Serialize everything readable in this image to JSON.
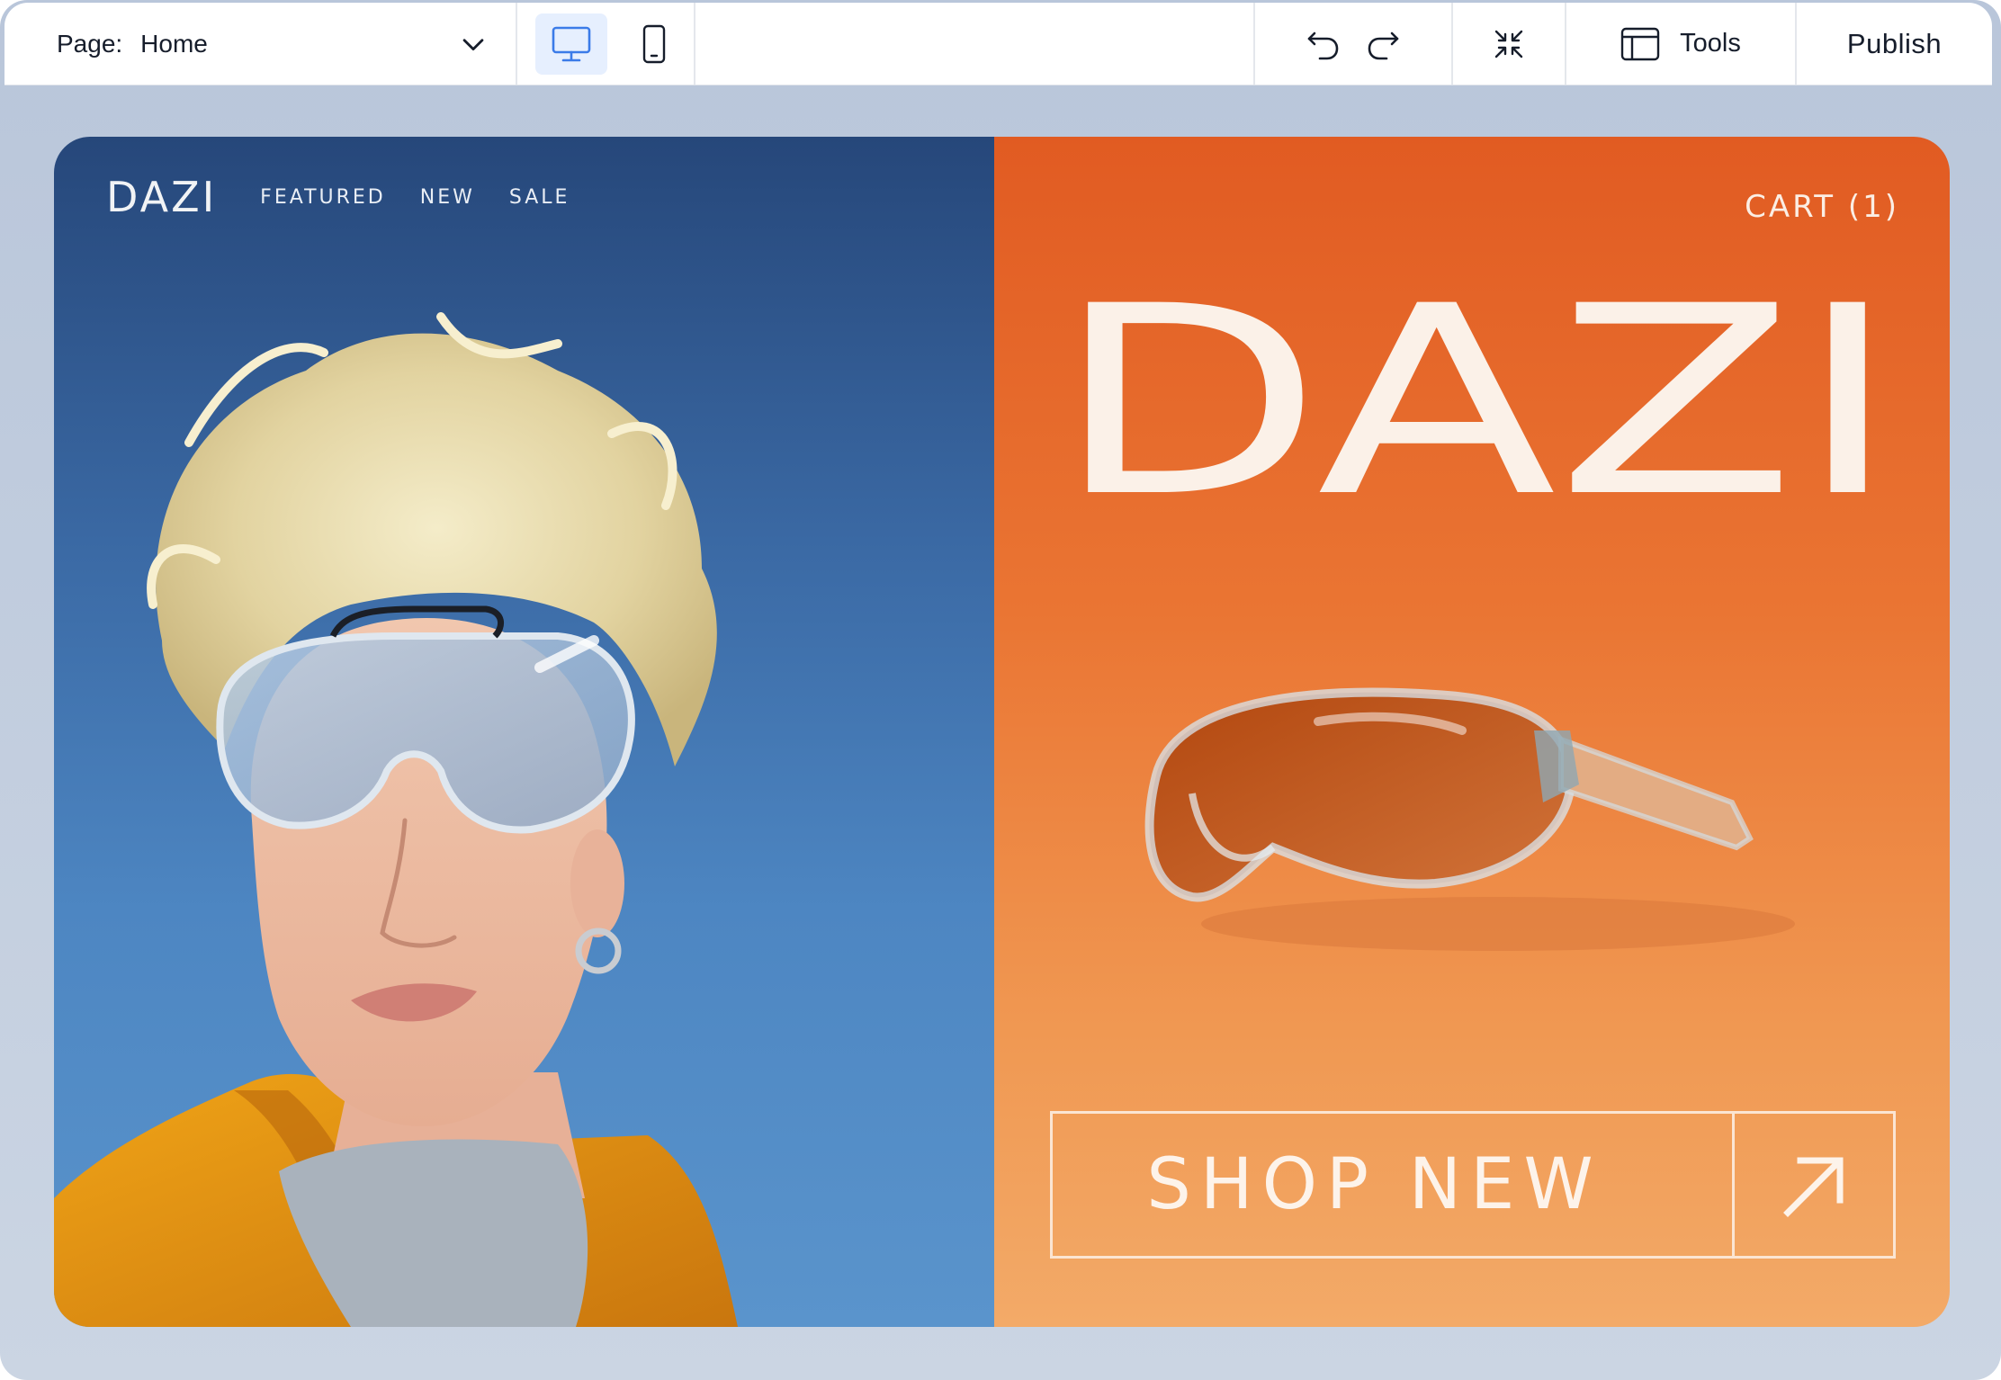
{
  "toolbar": {
    "page_key": "Page:",
    "page_value": "Home",
    "tools_label": "Tools",
    "publish_label": "Publish",
    "active_device": "desktop"
  },
  "site": {
    "logo_small": "DAZI",
    "nav": [
      "FEATURED",
      "NEW",
      "SALE"
    ],
    "cart": "CART (1)",
    "hero_title": "DAZI",
    "cta_label": "SHOP NEW"
  },
  "colors": {
    "accent_blue": "#3b7be8",
    "left_panel": "#3b6aa5",
    "right_panel": "#e8692b",
    "cream": "#fbf1e8"
  },
  "icons": {
    "page_dropdown": "chevron-down-icon",
    "desktop": "desktop-icon",
    "mobile": "mobile-icon",
    "undo": "undo-icon",
    "redo": "redo-icon",
    "zoom_out": "collapse-icon",
    "tools": "panel-layout-icon",
    "cta": "arrow-up-right-icon"
  }
}
